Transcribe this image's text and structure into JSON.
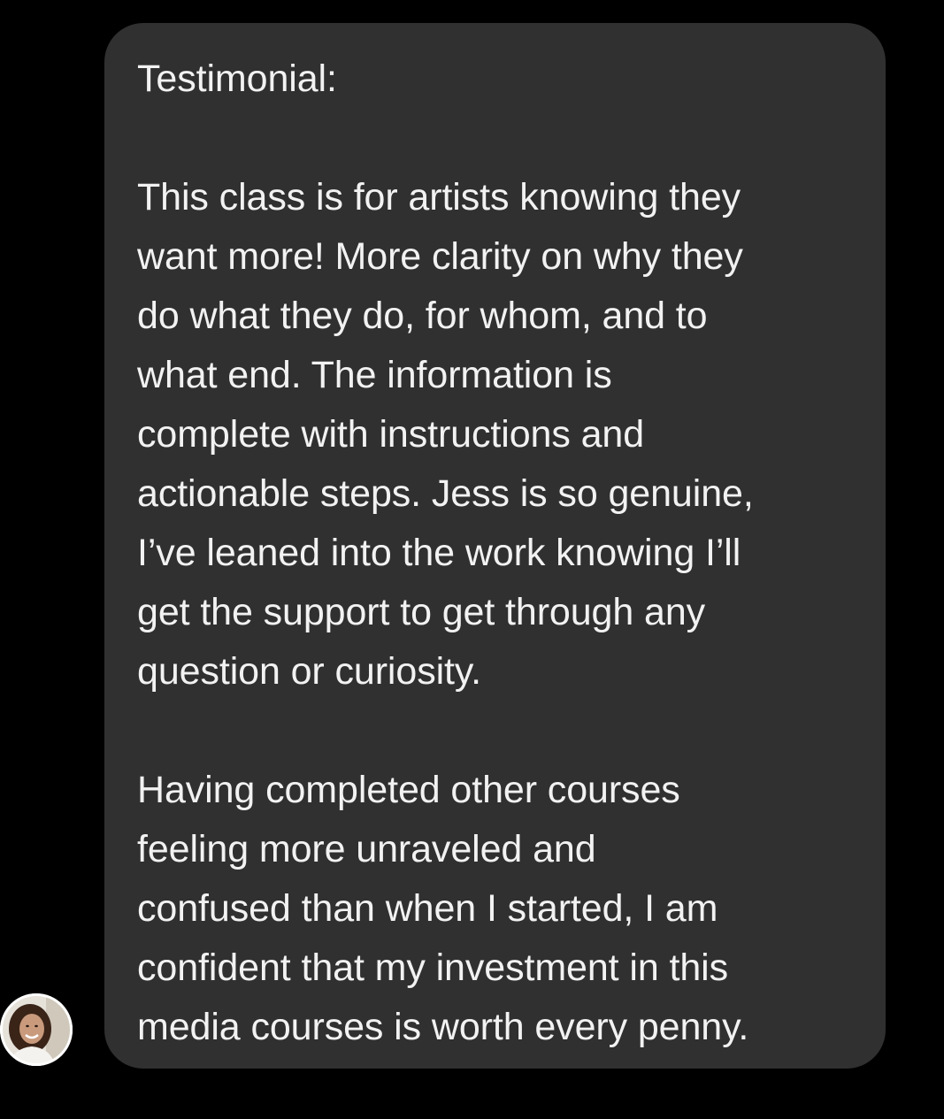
{
  "message": {
    "heading": "Testimonial:",
    "paragraph1": [
      "This class is for artists knowing they",
      "want more! More clarity on why they",
      "do what they do, for whom, and to",
      "what end. The information is",
      "complete with instructions and",
      "actionable steps. Jess is so genuine,",
      "I’ve leaned into the work knowing I’ll",
      "get the support to get through any",
      "question or curiosity."
    ],
    "paragraph2": [
      "Having completed other courses",
      "feeling more unraveled and",
      "confused than when I started, I am",
      "confident that my investment in this",
      "media courses is worth every penny."
    ]
  },
  "sender": {
    "avatar_icon": "user-avatar-photo"
  },
  "colors": {
    "background": "#000000",
    "bubble": "#303030",
    "text": "#f2f2f2"
  }
}
